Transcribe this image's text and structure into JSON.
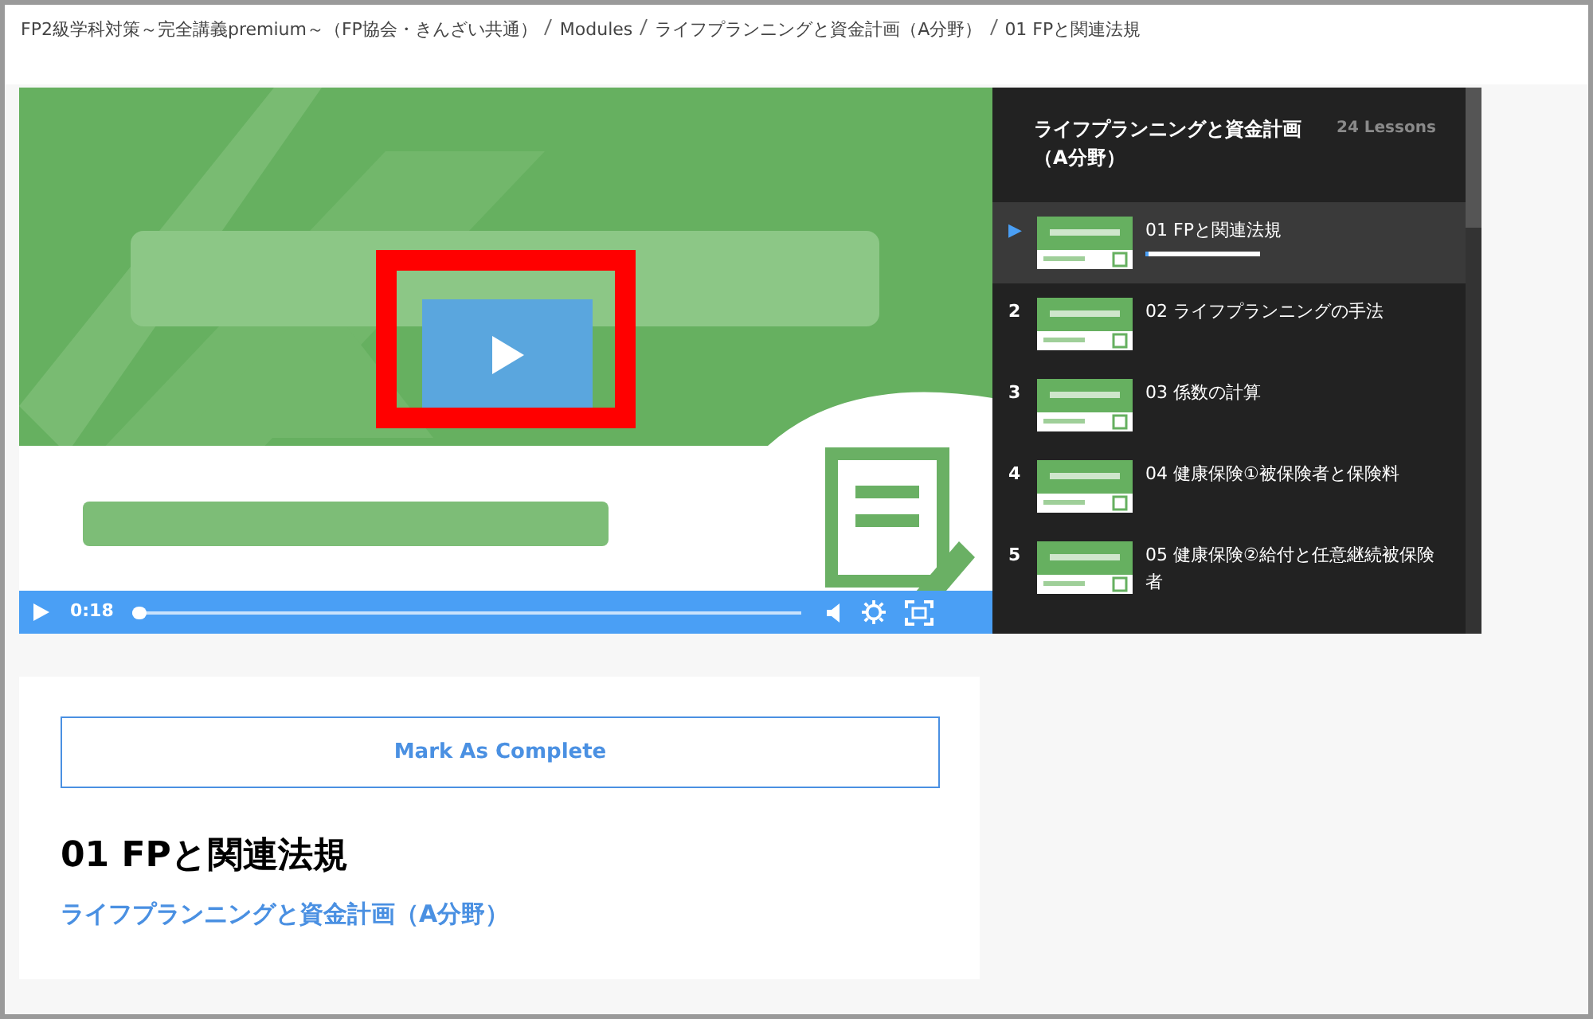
{
  "breadcrumb": [
    {
      "label": "FP2級学科対策～完全講義premium～（FP協会・きんざい共通）"
    },
    {
      "label": "Modules"
    },
    {
      "label": "ライフプランニングと資金計画（A分野）"
    },
    {
      "label": "01 FPと関連法規"
    }
  ],
  "video": {
    "kind": "picture",
    "time": "0:18",
    "level": 0.02,
    "highlighted": true
  },
  "playlist": {
    "title": "ライフプランニングと資金計画（A分野）",
    "count": "24 Lessons",
    "lessons": [
      {
        "number": "▶",
        "title": "01 FPと関連法規",
        "selected": true,
        "level": 0.03
      },
      {
        "number": "2",
        "title": "02 ライフプランニングの手法",
        "selected": false
      },
      {
        "number": "3",
        "title": "03 係数の計算",
        "selected": false
      },
      {
        "number": "4",
        "title": "04 健康保険①被保険者と保険料",
        "selected": false
      },
      {
        "number": "5",
        "title": "05 健康保険②給付と任意継続被保険者",
        "selected": false
      }
    ]
  },
  "complete_button": "Mark As Complete",
  "lesson_title": "01 FPと関連法規",
  "module_link": "ライフプランニングと資金計画（A分野）"
}
